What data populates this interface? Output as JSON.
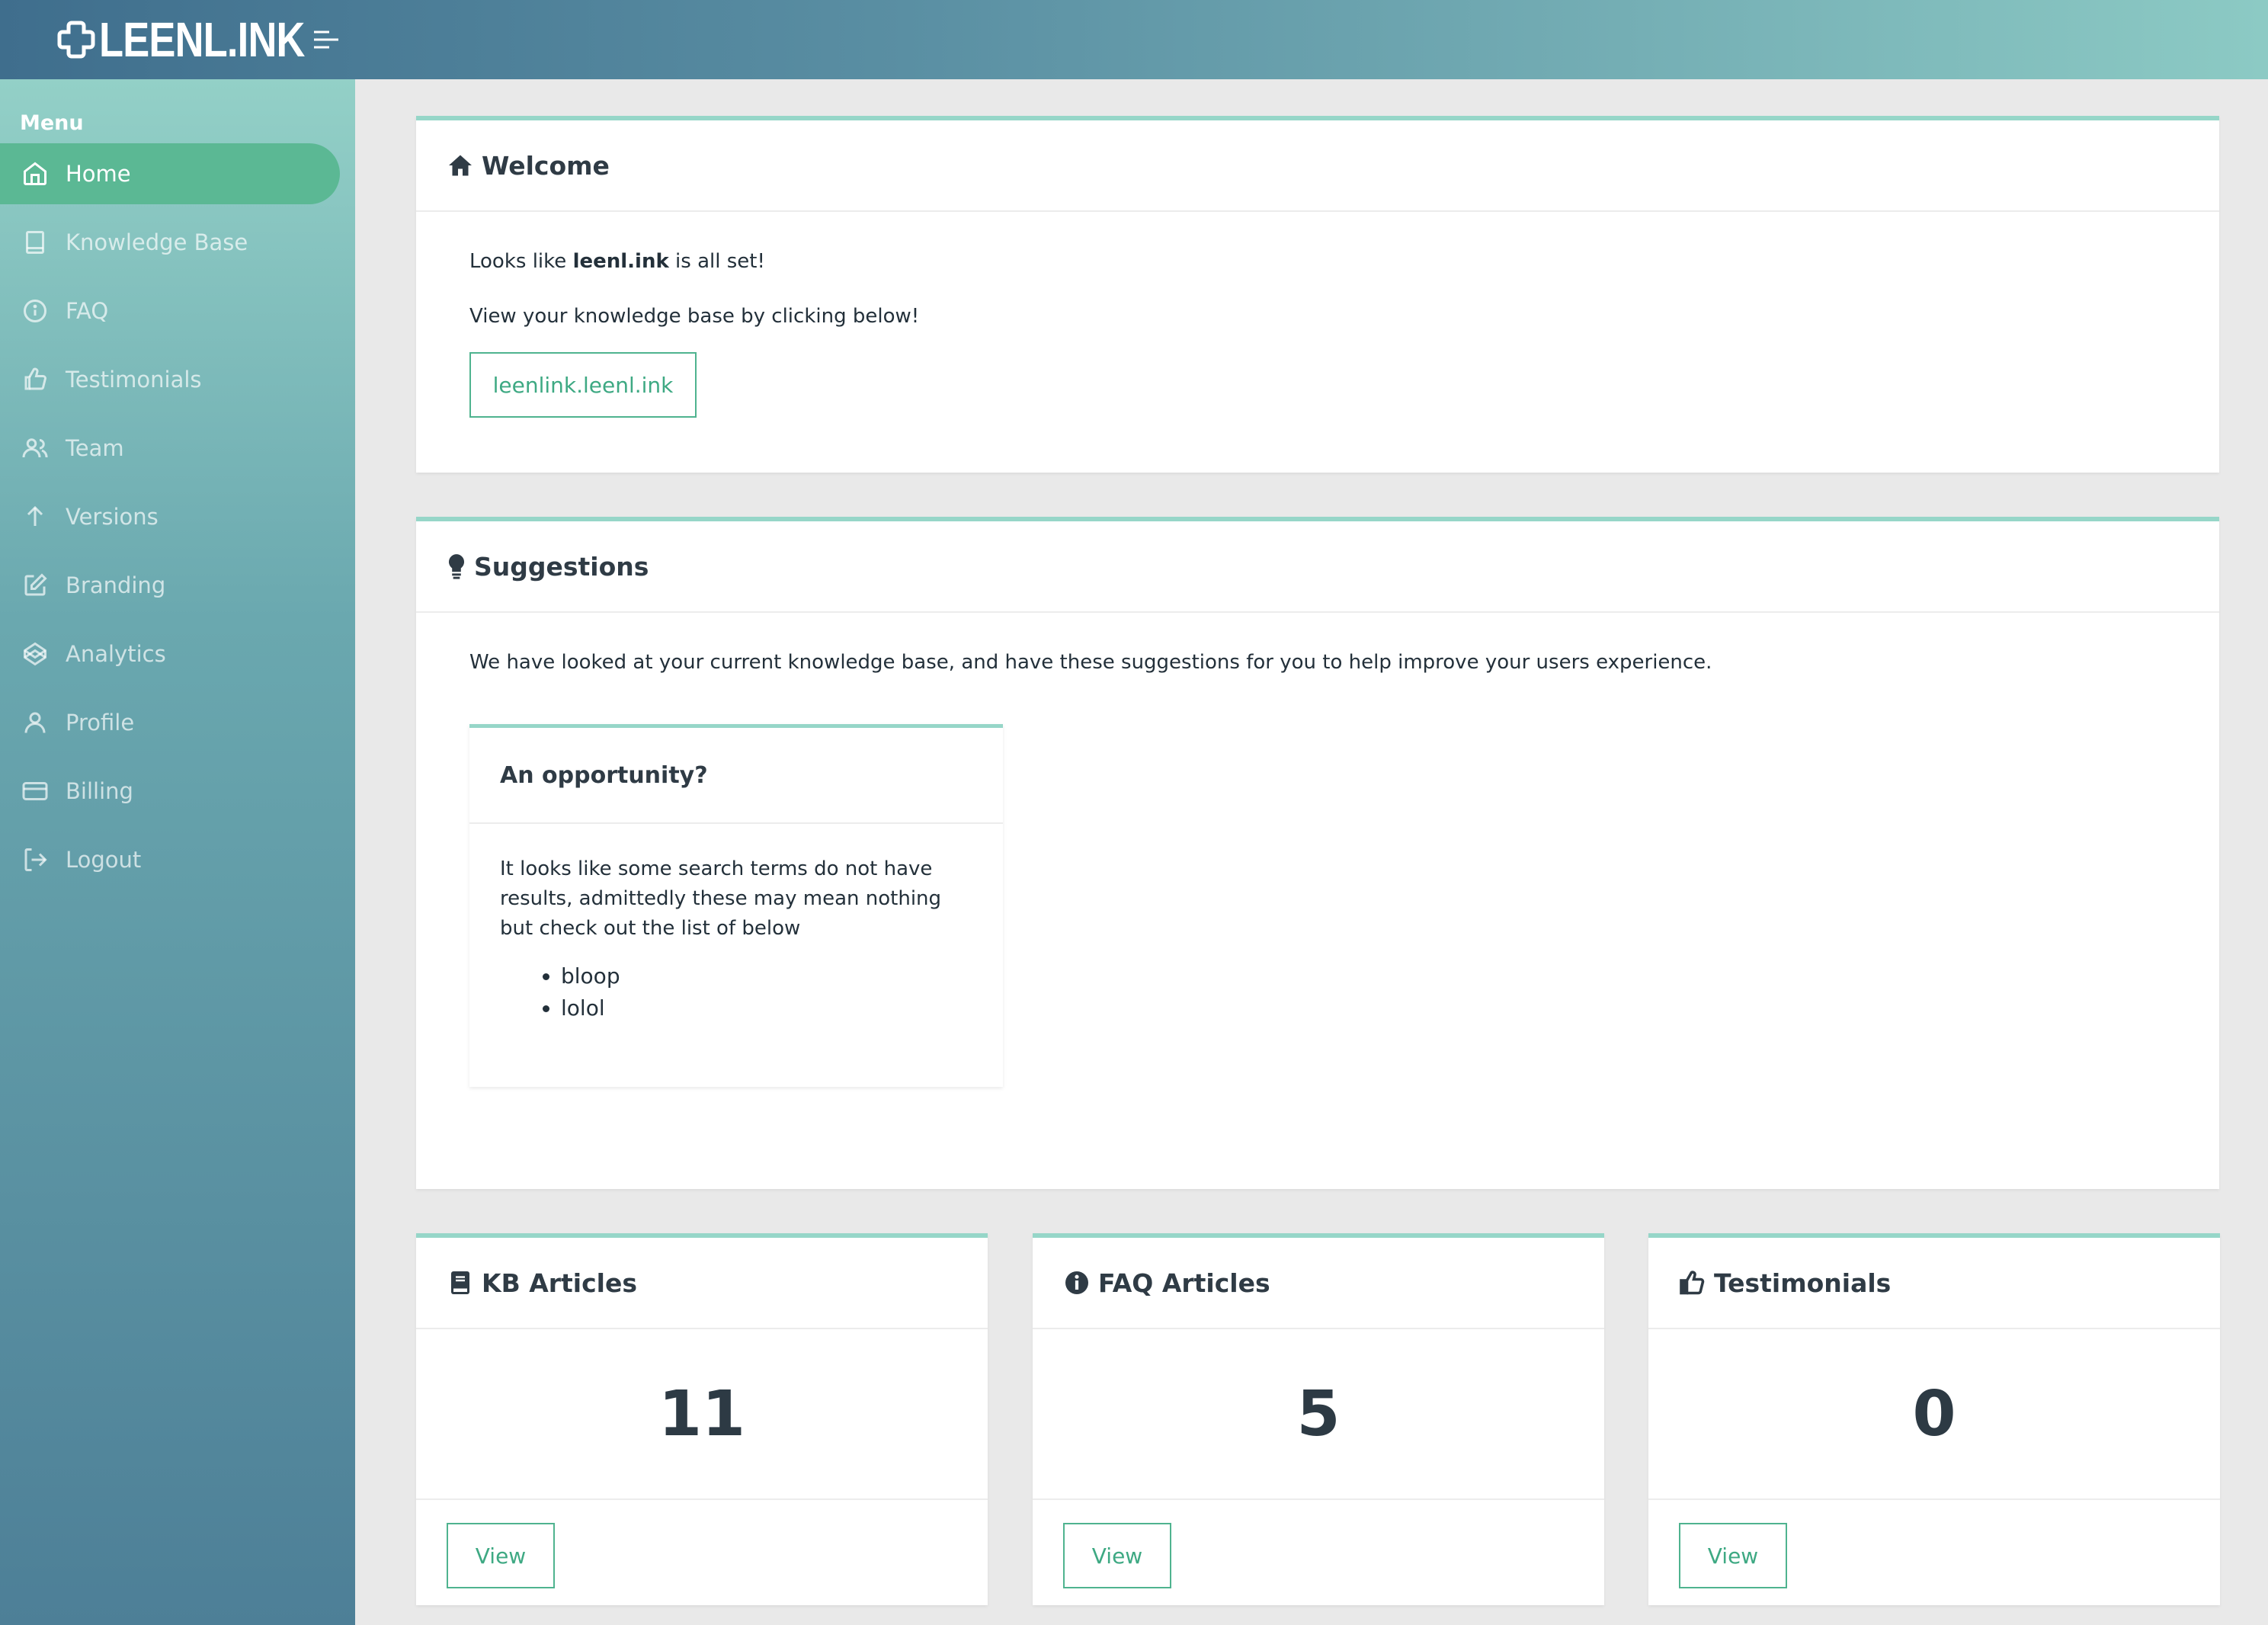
{
  "header": {
    "logo_text": "LEENL.INK",
    "logo_icon": "plus-logo-icon",
    "menu_icon": "hamburger-icon"
  },
  "sidebar": {
    "title": "Menu",
    "items": [
      {
        "label": "Home",
        "icon": "home-icon",
        "active": true
      },
      {
        "label": "Knowledge Base",
        "icon": "book-icon"
      },
      {
        "label": "FAQ",
        "icon": "info-icon"
      },
      {
        "label": "Testimonials",
        "icon": "thumbs-up-icon"
      },
      {
        "label": "Team",
        "icon": "users-icon"
      },
      {
        "label": "Versions",
        "icon": "arrow-up-icon"
      },
      {
        "label": "Branding",
        "icon": "edit-icon"
      },
      {
        "label": "Analytics",
        "icon": "codepen-icon"
      },
      {
        "label": "Profile",
        "icon": "user-icon"
      },
      {
        "label": "Billing",
        "icon": "credit-card-icon"
      },
      {
        "label": "Logout",
        "icon": "logout-icon"
      }
    ]
  },
  "welcome": {
    "title": "Welcome",
    "line1_prefix": "Looks like ",
    "line1_bold": "leenl.ink",
    "line1_suffix": " is all set!",
    "line2": "View your knowledge base by clicking below!",
    "link_label": "leenlink.leenl.ink"
  },
  "suggestions": {
    "title": "Suggestions",
    "intro": "We have looked at your current knowledge base, and have these suggestions for you to help improve your users experience.",
    "opportunity": {
      "title": "An opportunity?",
      "body": "It looks like some search terms do not have results, admittedly these may mean nothing but check out the list of below",
      "terms": [
        "bloop",
        "lolol"
      ]
    }
  },
  "stats": [
    {
      "title": "KB Articles",
      "icon": "book-solid-icon",
      "value": "11",
      "button": "View"
    },
    {
      "title": "FAQ Articles",
      "icon": "info-circle-solid-icon",
      "value": "5",
      "button": "View"
    },
    {
      "title": "Testimonials",
      "icon": "thumbs-up-solid-icon",
      "value": "0",
      "button": "View"
    }
  ],
  "colors": {
    "accent": "#5bb894",
    "card_border": "#96d6c8",
    "button_text": "#3ea983"
  }
}
